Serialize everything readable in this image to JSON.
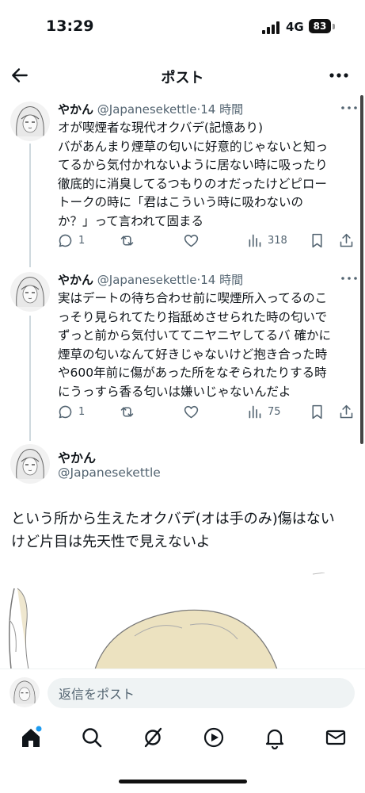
{
  "status": {
    "time": "13:29",
    "network": "4G",
    "battery": "83"
  },
  "header": {
    "title": "ポスト"
  },
  "tweets": [
    {
      "name": "やかん",
      "handle": "@Japanesekettle",
      "time": "14 時間",
      "lines": [
        "オが喫煙者な現代オクバデ(記憶あり)",
        "バがあんまり煙草の匂いに好意的じゃないと知っ",
        "てるから気付かれないように居ない時に吸ったり",
        "徹底的に消臭してるつもりのオだったけどピロー",
        "トークの時に「君はこういう時に吸わないの",
        "か？」って言われて固まる"
      ],
      "replies": "1",
      "views": "318"
    },
    {
      "name": "やかん",
      "handle": "@Japanesekettle",
      "time": "14 時間",
      "lines": [
        "実はデートの待ち合わせ前に喫煙所入ってるのこ",
        "っそり見られてたり指舐めさせられた時の匂いで",
        "ずっと前から気付いててニヤニヤしてるバ 確かに",
        "煙草の匂いなんて好きじゃないけど抱き合った時",
        "や600年前に傷があった所をなぞられたりする時",
        "にうっすら香る匂いは嫌いじゃないんだよ"
      ],
      "replies": "1",
      "views": "75"
    }
  ],
  "main_post": {
    "name": "やかん",
    "handle": "@Japanesekettle",
    "lines": [
      "という所から生えたオクバデ(オは手のみ)傷はない",
      "けど片目は先天性で見えないよ"
    ]
  },
  "reply": {
    "placeholder": "返信をポスト"
  },
  "icons": {
    "back": "arrow-left-icon",
    "more": "more-horizontal-icon",
    "reply": "reply-icon",
    "retweet": "retweet-icon",
    "like": "heart-icon",
    "views": "views-icon",
    "bookmark": "bookmark-icon",
    "share": "share-icon",
    "home": "home-icon",
    "search": "search-icon",
    "grok": "grok-icon",
    "video": "video-icon",
    "notifications": "bell-icon",
    "messages": "mail-icon"
  },
  "colors": {
    "text": "#0f1419",
    "secondary": "#536471",
    "accent": "#1d9bf0",
    "input_bg": "#eff3f4"
  }
}
